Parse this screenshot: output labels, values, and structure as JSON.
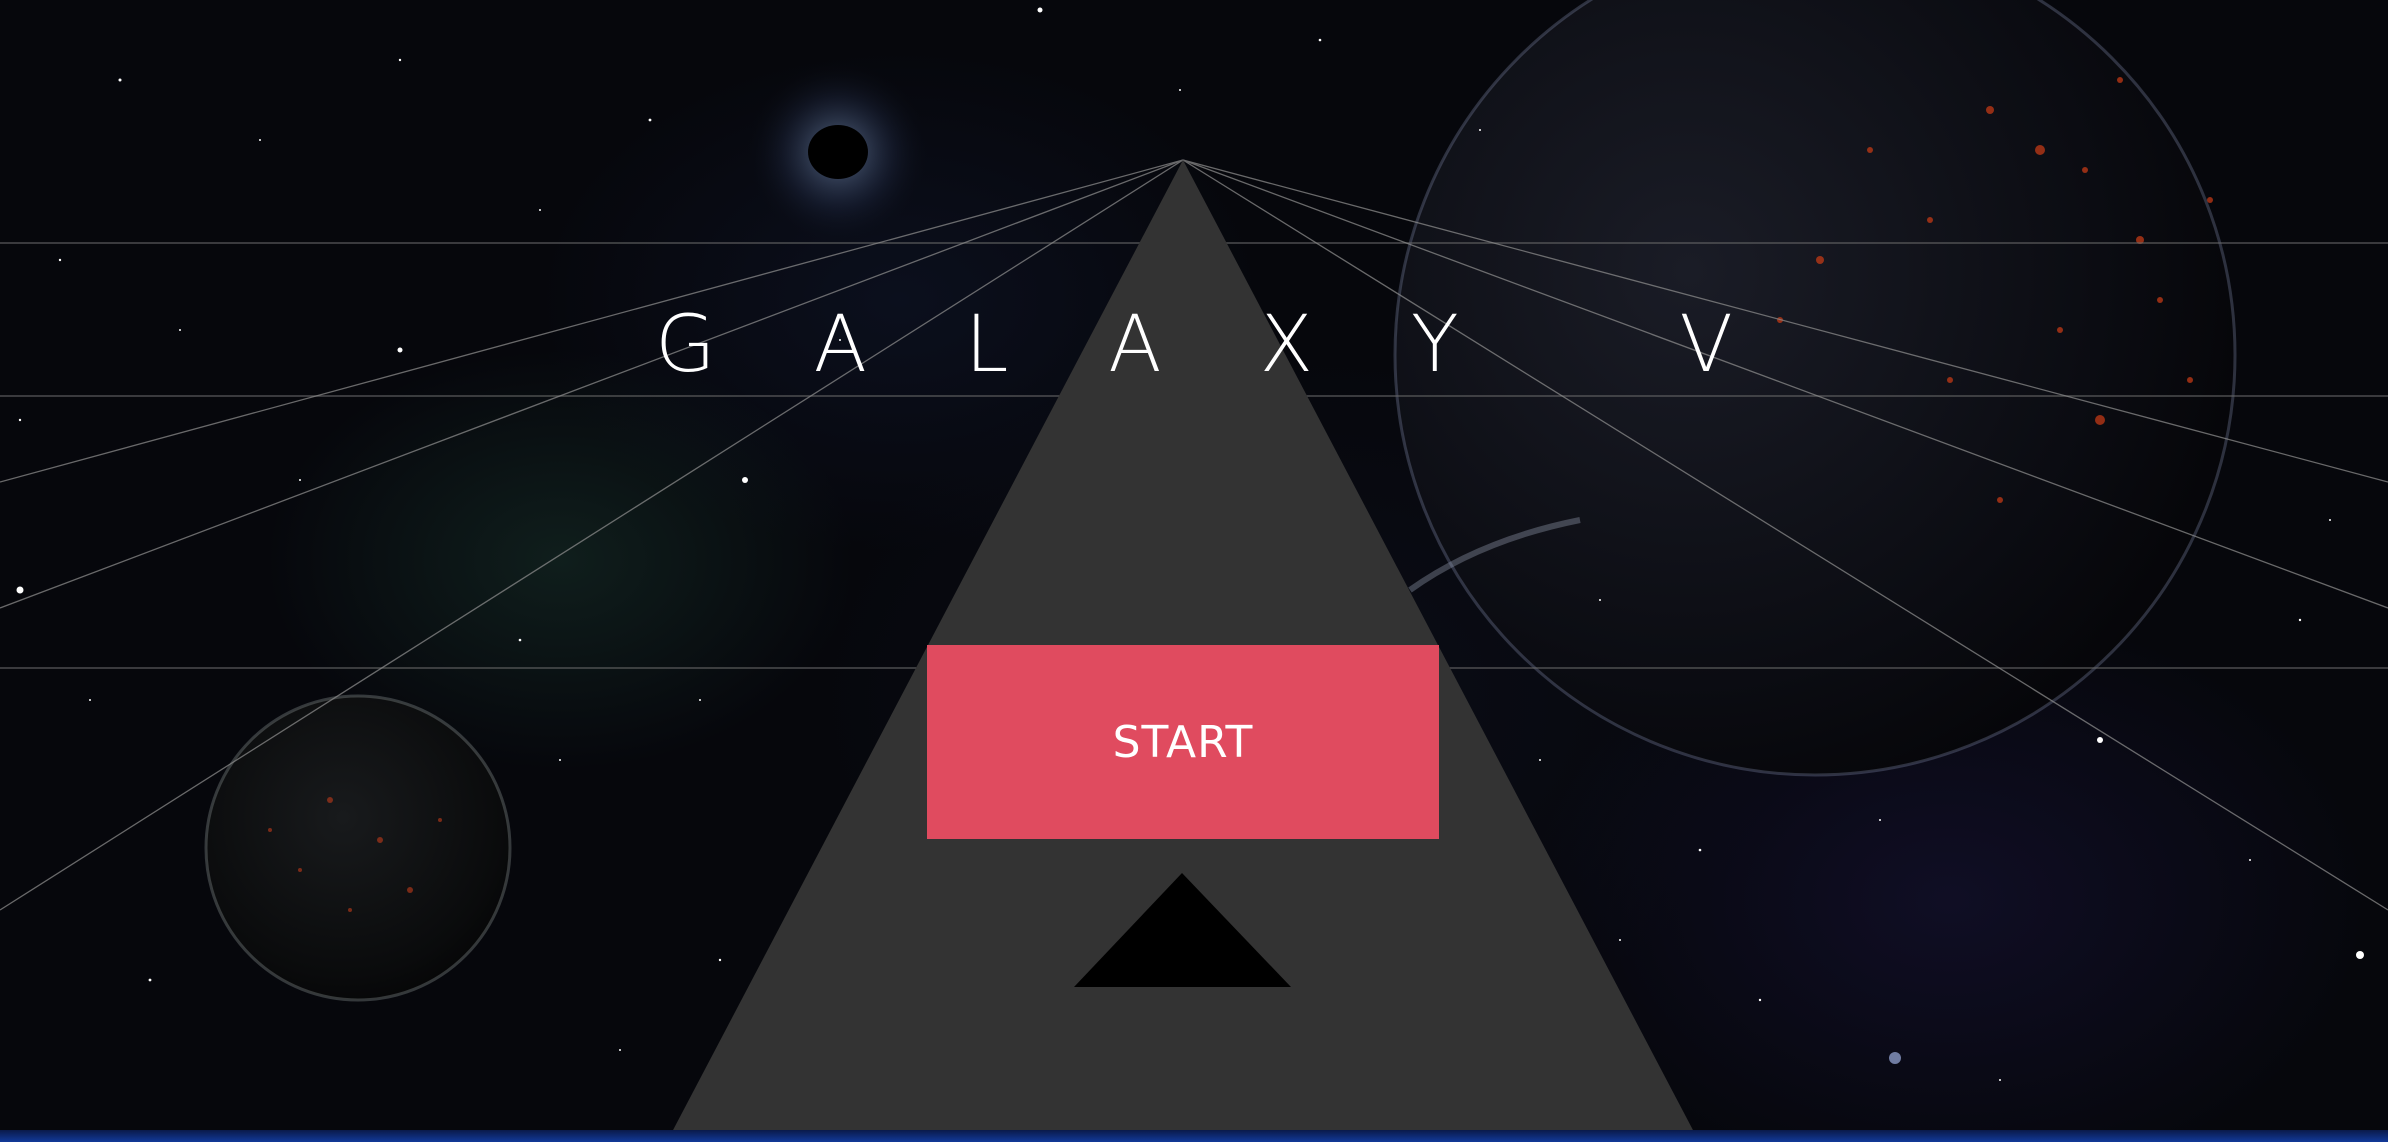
{
  "game": {
    "title": "GALAXY V",
    "start_label": "START"
  },
  "colors": {
    "background": "#06070c",
    "pyramid": "#333333",
    "start_button": "#e04b5f",
    "grid_lines": "#6a6a6a",
    "inner_triangle": "#000000",
    "bottom_bar": "#123a9a"
  },
  "icons": {
    "down_arrow": "triangle-icon"
  }
}
